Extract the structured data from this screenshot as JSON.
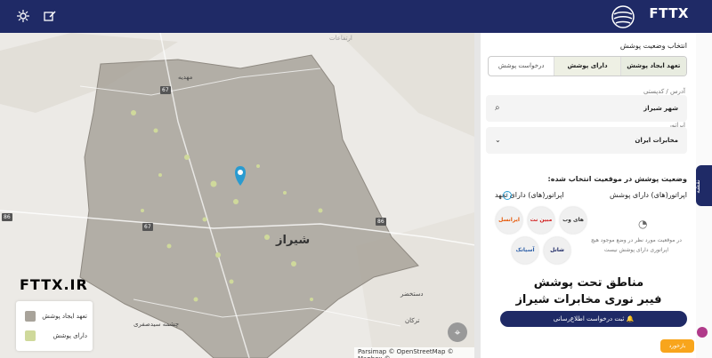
{
  "header": {
    "brand": "FTTX",
    "icons": [
      "settings-icon",
      "edit-icon"
    ]
  },
  "map": {
    "city_label": "شیراز",
    "labels": [
      "مهدیه",
      "دستخضر",
      "ترکان",
      "چشمه سیدصفری",
      "ارتفاعات"
    ],
    "road_shields": [
      "67",
      "86",
      "86",
      "67"
    ],
    "brand_overlay": "FTTX.IR",
    "legend": [
      {
        "label": "تعهد ایجاد پوشش",
        "color": "#a8a39a"
      },
      {
        "label": "دارای پوشش",
        "color": "#cfd99b"
      }
    ],
    "attribution": "Parsimap © OpenStreetMap © Mapbox ©"
  },
  "panel": {
    "title": "انتخاب وضعیت پوشش",
    "tabs": [
      "تعهد ایجاد پوشش",
      "دارای پوشش",
      "درخواست پوشش"
    ],
    "address": {
      "label": "آدرس / کدپستی",
      "value": "شهر شیراز"
    },
    "operator": {
      "label": "اپراتور",
      "value": "مخابرات ایران"
    },
    "section_title": "وضعیت پوشش در موقعیت انتخاب شده:",
    "col_covered": "اپراتور(های) دارای پوشش",
    "col_committed": "اپراتور(های) دارای تعهد",
    "no_coverage_text": "در موقعیت مورد نظر در وضع موجود هیچ اپراتوری دارای پوشش نیست",
    "operators": [
      "ایرانسل",
      "مبین نت",
      "های وب",
      "شاتل",
      "آسیاتک"
    ],
    "promo_line1": "مناطق تحت پوشش",
    "promo_line2": "فیبر نوری مخابرات شیراز",
    "cta": "ثبت درخواست اطلاع‌رسانی",
    "side_tab": "نقشه",
    "feedback": "بازخورد"
  },
  "colors": {
    "header": "#1f2a66",
    "committed_area": "#a8a39a",
    "covered_area": "#cfd99b",
    "accent": "#f8a51c"
  }
}
